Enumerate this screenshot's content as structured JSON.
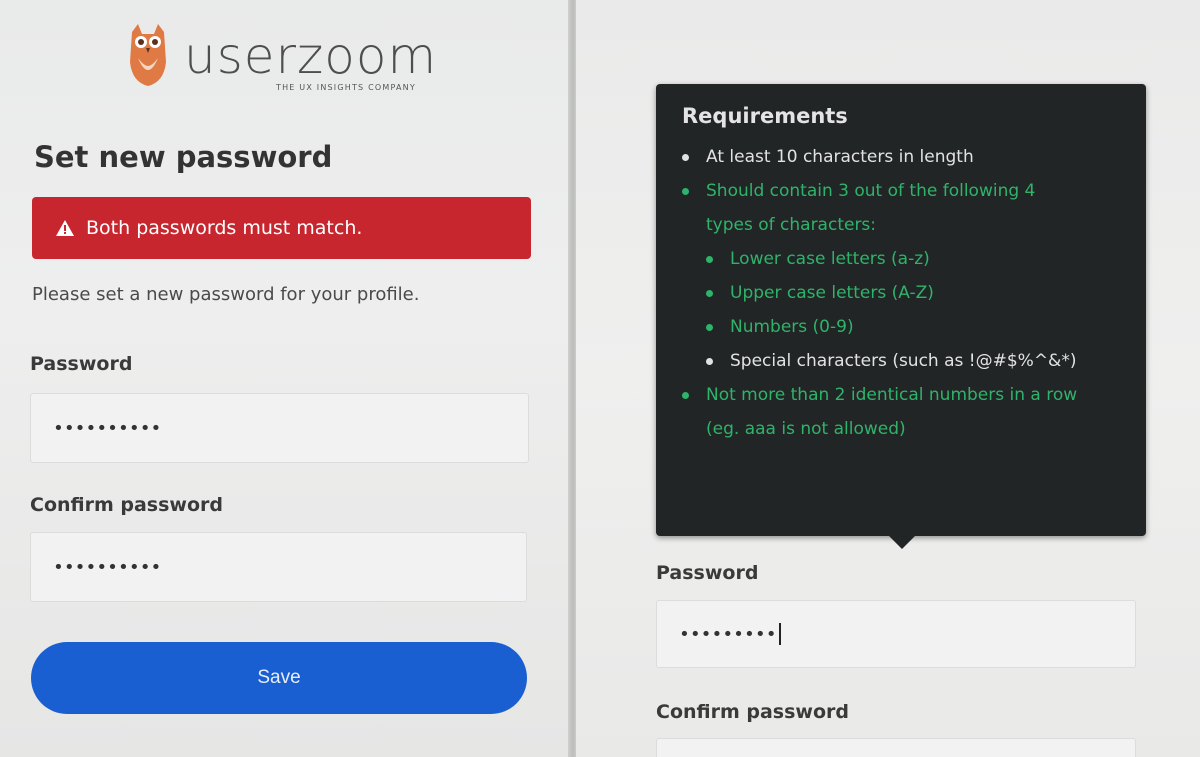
{
  "brand": {
    "name": "userzoom",
    "tagline": "THE UX INSIGHTS COMPANY",
    "owl_color": "#e07a45"
  },
  "left": {
    "title": "Set new password",
    "alert": "Both passwords must match.",
    "intro": "Please set a new password for your profile.",
    "password_label": "Password",
    "password_value": "••••••••••",
    "confirm_label": "Confirm password",
    "confirm_value": "••••••••••",
    "save_label": "Save"
  },
  "right": {
    "requirements": {
      "title": "Requirements",
      "items": [
        {
          "text": "At least 10 characters in length",
          "state": "pending"
        },
        {
          "text": "Should contain 3 out of the following 4 types of characters:",
          "state": "ok"
        },
        {
          "text": "Lower case letters (a-z)",
          "state": "ok"
        },
        {
          "text": "Upper case letters (A-Z)",
          "state": "ok"
        },
        {
          "text": "Numbers (0-9)",
          "state": "ok"
        },
        {
          "text": "Special characters (such as !@#$%^&*)",
          "state": "pending"
        },
        {
          "text": "Not more than 2 identical numbers in a row (eg. aaa is not allowed)",
          "state": "ok"
        }
      ]
    },
    "password_label": "Password",
    "password_value": "•••••••••",
    "confirm_label": "Confirm password"
  },
  "colors": {
    "alert": "#c8262e",
    "primary": "#1a5fd1",
    "ok": "#2fb36a",
    "tooltip_bg": "#222526"
  }
}
